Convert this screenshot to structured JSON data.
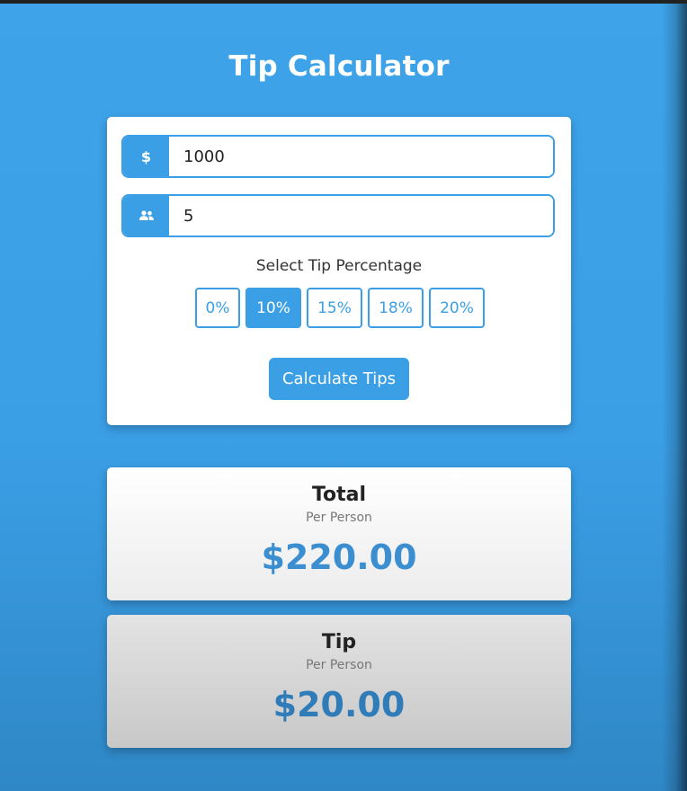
{
  "app": {
    "title": "Tip Calculator"
  },
  "inputs": {
    "bill": {
      "icon": "dollar-icon",
      "symbol": "$",
      "value": "1000"
    },
    "people": {
      "icon": "users-icon",
      "value": "5"
    }
  },
  "tip_selector": {
    "label": "Select Tip Percentage",
    "options": [
      "0%",
      "10%",
      "15%",
      "18%",
      "20%"
    ],
    "selected": "10%"
  },
  "calculate_button": {
    "label": "Calculate Tips"
  },
  "results": {
    "total": {
      "heading": "Total",
      "sub": "Per Person",
      "value": "$220.00"
    },
    "tip": {
      "heading": "Tip",
      "sub": "Per Person",
      "value": "$20.00"
    }
  },
  "colors": {
    "accent": "#3b9fe6",
    "background": "#3ea3e8",
    "value_text": "#3b8fd0"
  }
}
